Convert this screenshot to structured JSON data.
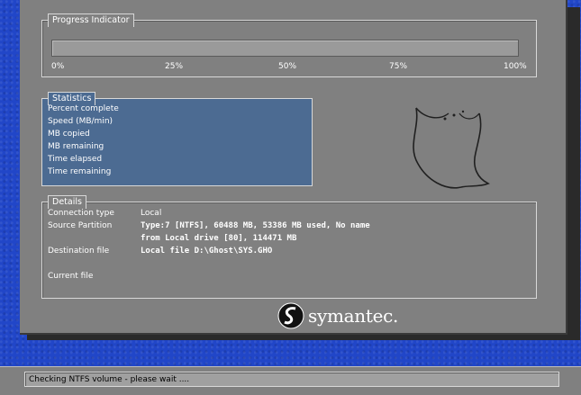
{
  "progress": {
    "title": "Progress Indicator",
    "value_percent": 0,
    "ticks": [
      "0%",
      "25%",
      "50%",
      "75%",
      "100%"
    ]
  },
  "statistics": {
    "title": "Statistics",
    "labels": [
      "Percent complete",
      "Speed (MB/min)",
      "MB copied",
      "MB remaining",
      "Time elapsed",
      "Time remaining"
    ]
  },
  "details": {
    "title": "Details",
    "connection_type_label": "Connection type",
    "connection_type_value": "Local",
    "source_partition_label": "Source Partition",
    "source_partition_line1": "Type:7 [NTFS], 60488 MB, 53386 MB used, No name",
    "source_partition_line2": "from Local drive [80], 114471 MB",
    "destination_file_label": "Destination file",
    "destination_file_value": "Local file D:\\Ghost\\SYS.GHO",
    "current_file_label": "Current file"
  },
  "brand": {
    "name": "symantec."
  },
  "status": {
    "text": "Checking NTFS volume - please wait ...."
  },
  "colors": {
    "background": "#2146c8",
    "window": "#808080",
    "stats_panel": "#4c6b92"
  },
  "icons": [
    "ghost-logo-icon",
    "symantec-logo-icon"
  ]
}
